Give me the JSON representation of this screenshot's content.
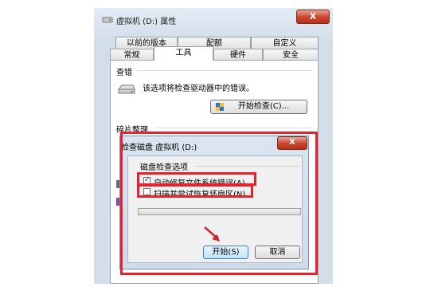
{
  "window": {
    "title": "虚拟机 (D:) 属性",
    "close": "X"
  },
  "tabs_top": [
    "以前的版本",
    "配额",
    "自定义"
  ],
  "tabs_bottom": [
    "常规",
    "工具",
    "硬件",
    "安全"
  ],
  "error_check": {
    "header": "查错",
    "description": "该选项将检查驱动器中的错误。",
    "button": "开始检查(C)..."
  },
  "defrag": {
    "header": "碎片整理"
  },
  "dialog": {
    "title": "检查磁盘 虚拟机 (D:)",
    "close": "X",
    "group_label": "磁盘检查选项",
    "option1": "自动修复文件系统错误(A)",
    "option1_checked": true,
    "option2": "扫描并尝试恢复坏扇区(N)",
    "option2_checked": false,
    "start_button": "开始(S)",
    "cancel_button": "取消"
  },
  "colors": {
    "highlight": "#e5232e",
    "arrow": "#d2232a"
  }
}
